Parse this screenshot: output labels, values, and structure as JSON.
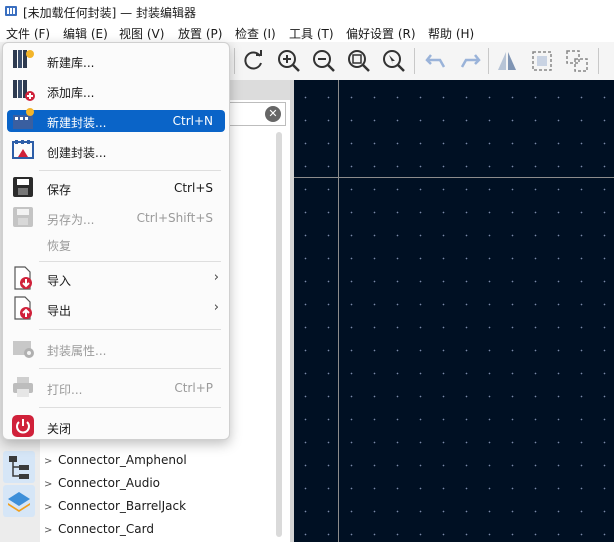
{
  "window": {
    "title": "[未加载任何封装] — 封装编辑器"
  },
  "menubar": [
    "文件 (F)",
    "编辑 (E)",
    "视图 (V)",
    "放置 (P)",
    "检查 (I)",
    "工具 (T)",
    "偏好设置 (R)",
    "帮助 (H)"
  ],
  "file_menu": {
    "items": [
      {
        "label": "新建库...",
        "shortcut": "",
        "icon": "new-library-icon",
        "state": "normal"
      },
      {
        "label": "添加库...",
        "shortcut": "",
        "icon": "add-library-icon",
        "state": "normal"
      },
      {
        "label": "新建封装...",
        "shortcut": "Ctrl+N",
        "icon": "new-footprint-icon",
        "state": "highlighted"
      },
      {
        "label": "创建封装...",
        "shortcut": "",
        "icon": "create-footprint-icon",
        "state": "normal"
      },
      {
        "label": "保存",
        "shortcut": "Ctrl+S",
        "icon": "save-icon",
        "state": "normal"
      },
      {
        "label": "另存为...",
        "shortcut": "Ctrl+Shift+S",
        "icon": "save-as-icon",
        "state": "disabled"
      },
      {
        "label": "恢复",
        "shortcut": "",
        "icon": "",
        "state": "disabled"
      },
      {
        "label": "导入",
        "shortcut": "",
        "icon": "import-icon",
        "state": "submenu"
      },
      {
        "label": "导出",
        "shortcut": "",
        "icon": "export-icon",
        "state": "submenu"
      },
      {
        "label": "封装属性...",
        "shortcut": "",
        "icon": "footprint-properties-icon",
        "state": "disabled"
      },
      {
        "label": "打印...",
        "shortcut": "Ctrl+P",
        "icon": "print-icon",
        "state": "disabled"
      },
      {
        "label": "关闭",
        "shortcut": "",
        "icon": "close-power-icon",
        "state": "normal"
      }
    ]
  },
  "library_tree": {
    "items": [
      "Connector_Amphenol",
      "Connector_Audio",
      "Connector_BarrelJack",
      "Connector_Card"
    ]
  },
  "colors": {
    "accent": "#0a64c8",
    "canvas_bg": "#001023"
  }
}
